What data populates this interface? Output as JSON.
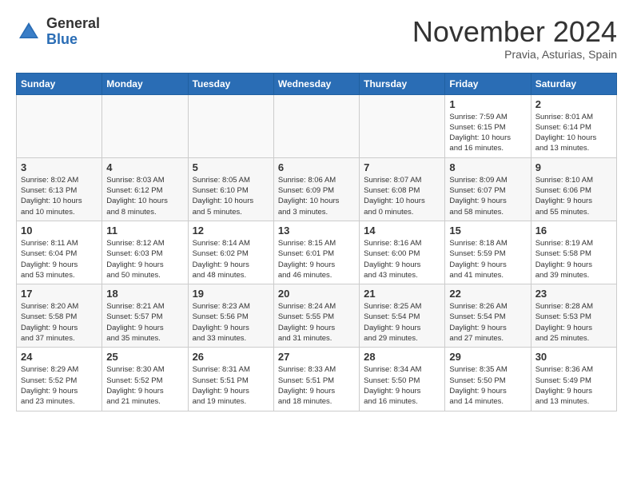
{
  "header": {
    "logo_general": "General",
    "logo_blue": "Blue",
    "month": "November 2024",
    "location": "Pravia, Asturias, Spain"
  },
  "days_of_week": [
    "Sunday",
    "Monday",
    "Tuesday",
    "Wednesday",
    "Thursday",
    "Friday",
    "Saturday"
  ],
  "weeks": [
    [
      {
        "date": "",
        "info": ""
      },
      {
        "date": "",
        "info": ""
      },
      {
        "date": "",
        "info": ""
      },
      {
        "date": "",
        "info": ""
      },
      {
        "date": "",
        "info": ""
      },
      {
        "date": "1",
        "info": "Sunrise: 7:59 AM\nSunset: 6:15 PM\nDaylight: 10 hours\nand 16 minutes."
      },
      {
        "date": "2",
        "info": "Sunrise: 8:01 AM\nSunset: 6:14 PM\nDaylight: 10 hours\nand 13 minutes."
      }
    ],
    [
      {
        "date": "3",
        "info": "Sunrise: 8:02 AM\nSunset: 6:13 PM\nDaylight: 10 hours\nand 10 minutes."
      },
      {
        "date": "4",
        "info": "Sunrise: 8:03 AM\nSunset: 6:12 PM\nDaylight: 10 hours\nand 8 minutes."
      },
      {
        "date": "5",
        "info": "Sunrise: 8:05 AM\nSunset: 6:10 PM\nDaylight: 10 hours\nand 5 minutes."
      },
      {
        "date": "6",
        "info": "Sunrise: 8:06 AM\nSunset: 6:09 PM\nDaylight: 10 hours\nand 3 minutes."
      },
      {
        "date": "7",
        "info": "Sunrise: 8:07 AM\nSunset: 6:08 PM\nDaylight: 10 hours\nand 0 minutes."
      },
      {
        "date": "8",
        "info": "Sunrise: 8:09 AM\nSunset: 6:07 PM\nDaylight: 9 hours\nand 58 minutes."
      },
      {
        "date": "9",
        "info": "Sunrise: 8:10 AM\nSunset: 6:06 PM\nDaylight: 9 hours\nand 55 minutes."
      }
    ],
    [
      {
        "date": "10",
        "info": "Sunrise: 8:11 AM\nSunset: 6:04 PM\nDaylight: 9 hours\nand 53 minutes."
      },
      {
        "date": "11",
        "info": "Sunrise: 8:12 AM\nSunset: 6:03 PM\nDaylight: 9 hours\nand 50 minutes."
      },
      {
        "date": "12",
        "info": "Sunrise: 8:14 AM\nSunset: 6:02 PM\nDaylight: 9 hours\nand 48 minutes."
      },
      {
        "date": "13",
        "info": "Sunrise: 8:15 AM\nSunset: 6:01 PM\nDaylight: 9 hours\nand 46 minutes."
      },
      {
        "date": "14",
        "info": "Sunrise: 8:16 AM\nSunset: 6:00 PM\nDaylight: 9 hours\nand 43 minutes."
      },
      {
        "date": "15",
        "info": "Sunrise: 8:18 AM\nSunset: 5:59 PM\nDaylight: 9 hours\nand 41 minutes."
      },
      {
        "date": "16",
        "info": "Sunrise: 8:19 AM\nSunset: 5:58 PM\nDaylight: 9 hours\nand 39 minutes."
      }
    ],
    [
      {
        "date": "17",
        "info": "Sunrise: 8:20 AM\nSunset: 5:58 PM\nDaylight: 9 hours\nand 37 minutes."
      },
      {
        "date": "18",
        "info": "Sunrise: 8:21 AM\nSunset: 5:57 PM\nDaylight: 9 hours\nand 35 minutes."
      },
      {
        "date": "19",
        "info": "Sunrise: 8:23 AM\nSunset: 5:56 PM\nDaylight: 9 hours\nand 33 minutes."
      },
      {
        "date": "20",
        "info": "Sunrise: 8:24 AM\nSunset: 5:55 PM\nDaylight: 9 hours\nand 31 minutes."
      },
      {
        "date": "21",
        "info": "Sunrise: 8:25 AM\nSunset: 5:54 PM\nDaylight: 9 hours\nand 29 minutes."
      },
      {
        "date": "22",
        "info": "Sunrise: 8:26 AM\nSunset: 5:54 PM\nDaylight: 9 hours\nand 27 minutes."
      },
      {
        "date": "23",
        "info": "Sunrise: 8:28 AM\nSunset: 5:53 PM\nDaylight: 9 hours\nand 25 minutes."
      }
    ],
    [
      {
        "date": "24",
        "info": "Sunrise: 8:29 AM\nSunset: 5:52 PM\nDaylight: 9 hours\nand 23 minutes."
      },
      {
        "date": "25",
        "info": "Sunrise: 8:30 AM\nSunset: 5:52 PM\nDaylight: 9 hours\nand 21 minutes."
      },
      {
        "date": "26",
        "info": "Sunrise: 8:31 AM\nSunset: 5:51 PM\nDaylight: 9 hours\nand 19 minutes."
      },
      {
        "date": "27",
        "info": "Sunrise: 8:33 AM\nSunset: 5:51 PM\nDaylight: 9 hours\nand 18 minutes."
      },
      {
        "date": "28",
        "info": "Sunrise: 8:34 AM\nSunset: 5:50 PM\nDaylight: 9 hours\nand 16 minutes."
      },
      {
        "date": "29",
        "info": "Sunrise: 8:35 AM\nSunset: 5:50 PM\nDaylight: 9 hours\nand 14 minutes."
      },
      {
        "date": "30",
        "info": "Sunrise: 8:36 AM\nSunset: 5:49 PM\nDaylight: 9 hours\nand 13 minutes."
      }
    ]
  ]
}
